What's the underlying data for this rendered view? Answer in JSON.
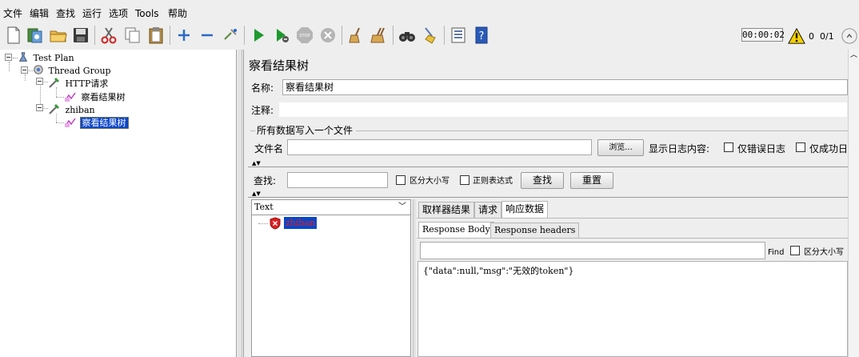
{
  "menu": {
    "items": [
      "文件",
      "编辑",
      "查找",
      "运行",
      "选项",
      "Tools",
      "帮助"
    ]
  },
  "toolbar": {
    "icons": [
      "new-icon",
      "templates-icon",
      "open-icon",
      "save-icon",
      "cut-icon",
      "copy-icon",
      "paste-icon",
      "expand-icon",
      "collapse-icon",
      "toggle-icon",
      "start-icon",
      "start-no-pause-icon",
      "stop-icon",
      "shutdown-icon",
      "clear-icon",
      "clear-all-icon",
      "search-icon",
      "reset-search-icon",
      "function-helper-icon",
      "help-icon"
    ],
    "timer": "00:00:02",
    "warning_count": "0",
    "threads": "0/1"
  },
  "tree": {
    "nodes": [
      {
        "label": "Test Plan",
        "icon": "test-plan-icon"
      },
      {
        "label": "Thread Group",
        "icon": "thread-group-icon"
      },
      {
        "label": "HTTP请求",
        "icon": "http-sampler-icon"
      },
      {
        "label": "察看结果树",
        "icon": "listener-icon"
      },
      {
        "label": "zhiban",
        "icon": "http-sampler-icon"
      },
      {
        "label": "察看结果树",
        "icon": "listener-icon",
        "selected": true
      }
    ]
  },
  "panel": {
    "title": "察看结果树",
    "name_label": "名称:",
    "name_value": "察看结果树",
    "comment_label": "注释:",
    "comment_value": "",
    "file_section_title": "所有数据写入一个文件",
    "filename_label": "文件名",
    "filename_value": "",
    "browse_button": "浏览...",
    "log_content_label": "显示日志内容:",
    "errors_only_label": "仅错误日志",
    "success_only_label": "仅成功日"
  },
  "search": {
    "label": "查找:",
    "value": "",
    "case_sensitive_label": "区分大小写",
    "regex_label": "正则表达式",
    "find_button": "查找",
    "reset_button": "重置"
  },
  "results": {
    "renderer": "Text",
    "items": [
      {
        "label": "zhiban",
        "status": "error"
      }
    ],
    "tabs": [
      "取样器结果",
      "请求",
      "响应数据"
    ],
    "active_tab": "响应数据",
    "subtabs": [
      "Response Body",
      "Response headers"
    ],
    "active_subtab": "Response Body",
    "find_label": "Find",
    "find_case_label": "区分大小写",
    "response_body": "{\"data\":null,\"msg\":\"无效的token\"}"
  },
  "colors": {
    "selection": "#0a46c8",
    "error_item": "#e02020",
    "run_green": "#1d9a2e"
  }
}
